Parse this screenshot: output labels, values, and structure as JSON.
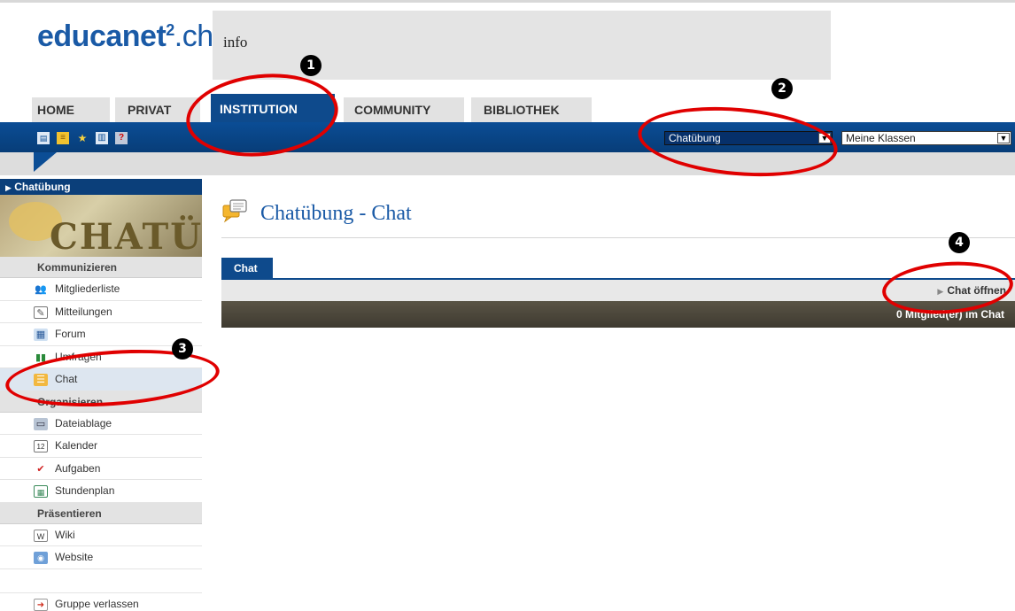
{
  "brand": {
    "name": "educanet",
    "sup": "2",
    "suffix": ".ch"
  },
  "header": {
    "info": "info"
  },
  "nav": {
    "tabs": [
      {
        "label": "HOME",
        "active": false
      },
      {
        "label": "PRIVAT",
        "active": false
      },
      {
        "label": "INSTITUTION",
        "active": true
      },
      {
        "label": "COMMUNITY",
        "active": false
      },
      {
        "label": "BIBLIOTHEK",
        "active": false
      }
    ]
  },
  "toolbar": {
    "icons": [
      "card-icon",
      "notes-icon",
      "favorites-icon",
      "print-icon",
      "help-icon"
    ],
    "group_select": "Chatübung",
    "class_select": "Meine Klassen"
  },
  "sidebar": {
    "group_title": "Chatübung",
    "banner_text": "CHATÜB",
    "sections": [
      {
        "title": "Kommunizieren",
        "items": [
          {
            "label": "Mitgliederliste",
            "icon": "members-icon",
            "active": false
          },
          {
            "label": "Mitteilungen",
            "icon": "messages-icon",
            "active": false
          },
          {
            "label": "Forum",
            "icon": "forum-icon",
            "active": false
          },
          {
            "label": "Umfragen",
            "icon": "poll-icon",
            "active": false
          },
          {
            "label": "Chat",
            "icon": "chat-icon",
            "active": true
          }
        ]
      },
      {
        "title": "Organisieren",
        "items": [
          {
            "label": "Dateiablage",
            "icon": "files-icon",
            "active": false
          },
          {
            "label": "Kalender",
            "icon": "calendar-icon",
            "active": false
          },
          {
            "label": "Aufgaben",
            "icon": "tasks-icon",
            "active": false
          },
          {
            "label": "Stundenplan",
            "icon": "timetable-icon",
            "active": false
          }
        ]
      },
      {
        "title": "Präsentieren",
        "items": [
          {
            "label": "Wiki",
            "icon": "wiki-icon",
            "active": false
          },
          {
            "label": "Website",
            "icon": "website-icon",
            "active": false
          }
        ]
      }
    ],
    "leave_group": "Gruppe verlassen"
  },
  "main": {
    "title": "Chatübung - Chat",
    "tab": "Chat",
    "chat_open": "Chat öffnen",
    "members": "0 Mitglied(er) im Chat"
  },
  "annotations": [
    "1",
    "2",
    "3",
    "4"
  ],
  "colors": {
    "brand_blue": "#0e4a8c",
    "annotation_red": "#e00000"
  }
}
